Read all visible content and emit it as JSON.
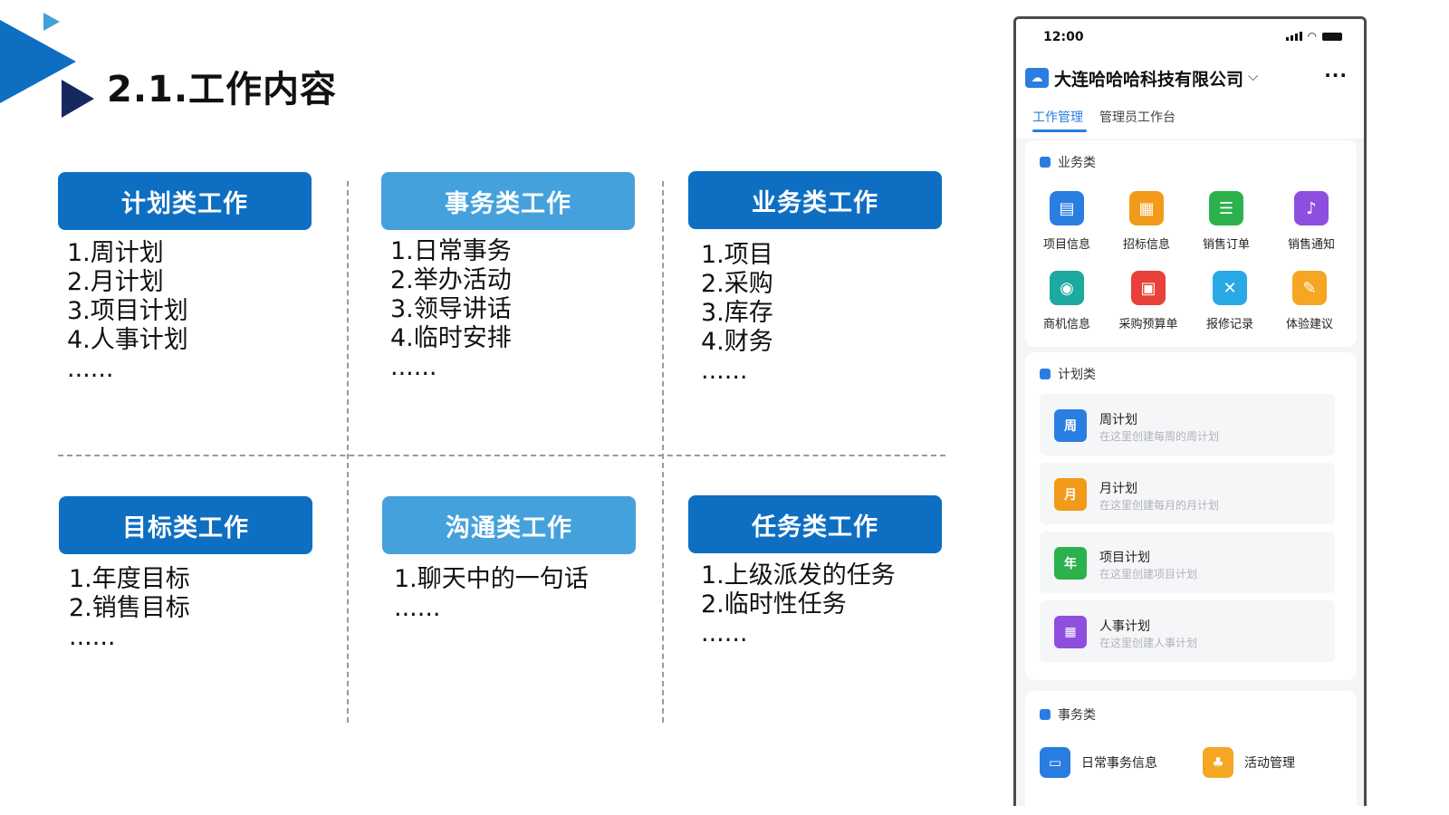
{
  "slide": {
    "title": "2.1.工作内容"
  },
  "colors": {
    "dark_blue": "#0e6fc2",
    "light_blue": "#45a1dc",
    "accent": "#2a7de1"
  },
  "cards": [
    {
      "title": "计划类工作",
      "items": [
        "1.周计划",
        "2.月计划",
        "3.项目计划",
        "4.人事计划",
        "......"
      ]
    },
    {
      "title": "事务类工作",
      "items": [
        "1.日常事务",
        "2.举办活动",
        "3.领导讲话",
        "4.临时安排",
        "......"
      ]
    },
    {
      "title": "业务类工作",
      "items": [
        "1.项目",
        "2.采购",
        "3.库存",
        "4.财务",
        "......"
      ]
    },
    {
      "title": "目标类工作",
      "items": [
        "1.年度目标",
        "2.销售目标",
        "......"
      ]
    },
    {
      "title": "沟通类工作",
      "items": [
        "1.聊天中的一句话",
        "......"
      ]
    },
    {
      "title": "任务类工作",
      "items": [
        "1.上级派发的任务",
        "2.临时性任务",
        "......"
      ]
    }
  ],
  "phone": {
    "time": "12:00",
    "company": "大连哈哈哈科技有限公司",
    "more": "···",
    "tabs": [
      "工作管理",
      "管理员工作台"
    ],
    "business": {
      "title": "业务类",
      "items": [
        {
          "label": "项目信息",
          "color": "#2a7de1",
          "icon": "document-icon"
        },
        {
          "label": "招标信息",
          "color": "#f29a1a",
          "icon": "file-icon"
        },
        {
          "label": "销售订单",
          "color": "#2bb24c",
          "icon": "list-icon"
        },
        {
          "label": "销售通知",
          "color": "#8e4ee0",
          "icon": "bell-icon"
        },
        {
          "label": "商机信息",
          "color": "#1ba9a0",
          "icon": "target-icon"
        },
        {
          "label": "采购预算单",
          "color": "#e8413a",
          "icon": "budget-icon"
        },
        {
          "label": "报修记录",
          "color": "#29a9e6",
          "icon": "wrench-icon"
        },
        {
          "label": "体验建议",
          "color": "#f5a623",
          "icon": "feedback-icon"
        }
      ]
    },
    "plan": {
      "title": "计划类",
      "items": [
        {
          "title": "周计划",
          "sub": "在这里创建每周的周计划",
          "color": "#2a7de1",
          "glyph": "周"
        },
        {
          "title": "月计划",
          "sub": "在这里创建每月的月计划",
          "color": "#f29a1a",
          "glyph": "月"
        },
        {
          "title": "项目计划",
          "sub": "在这里创建项目计划",
          "color": "#2bb24c",
          "glyph": "年"
        },
        {
          "title": "人事计划",
          "sub": "在这里创建人事计划",
          "color": "#8e4ee0",
          "glyph": ""
        }
      ]
    },
    "affairs": {
      "title": "事务类",
      "items": [
        {
          "label": "日常事务信息",
          "color": "#2a7de1"
        },
        {
          "label": "活动管理",
          "color": "#f5a623"
        }
      ]
    }
  }
}
